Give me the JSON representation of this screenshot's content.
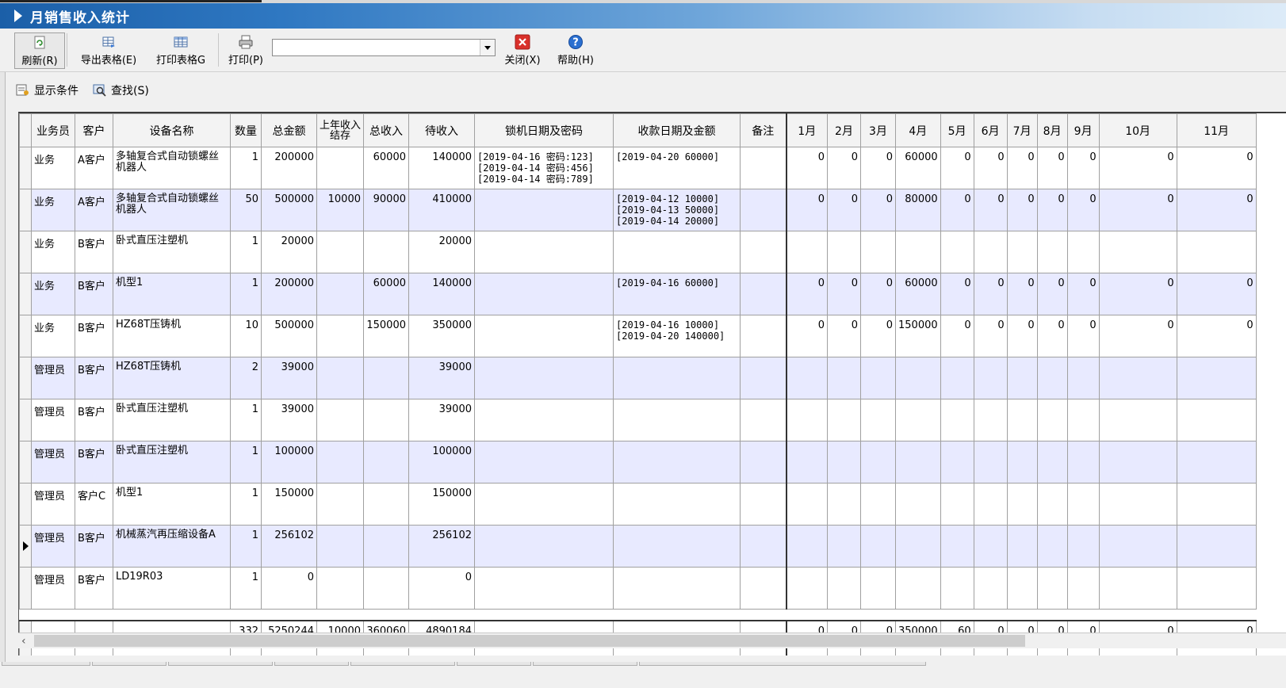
{
  "window": {
    "title": "月销售收入统计"
  },
  "toolbar": {
    "refresh": "刷新(R)",
    "export": "导出表格(E)",
    "print_table": "打印表格G",
    "print": "打印(P)",
    "print_select_value": "",
    "close": "关闭(X)",
    "help": "帮助(H)"
  },
  "subbar": {
    "show_conditions": "显示条件",
    "find": "查找(S)"
  },
  "grid": {
    "columns": [
      "业务员",
      "客户",
      "设备名称",
      "数量",
      "总金额",
      "上年收入结存",
      "总收入",
      "待收入",
      "锁机日期及密码",
      "收款日期及金额",
      "备注",
      "1月",
      "2月",
      "3月",
      "4月",
      "5月",
      "6月",
      "7月",
      "8月",
      "9月",
      "10月",
      "11月"
    ],
    "rows": [
      [
        "业务",
        "A客户",
        "多轴复合式自动锁螺丝机器人",
        "1",
        "200000",
        "",
        "60000",
        "140000",
        "[2019-04-16 密码:123]\n[2019-04-14 密码:456]\n[2019-04-14 密码:789]",
        "[2019-04-20 60000]",
        "",
        "0",
        "0",
        "0",
        "60000",
        "0",
        "0",
        "0",
        "0",
        "0",
        "0",
        "0"
      ],
      [
        "业务",
        "A客户",
        "多轴复合式自动锁螺丝机器人",
        "50",
        "500000",
        "10000",
        "90000",
        "410000",
        "",
        "[2019-04-12 10000]\n[2019-04-13 50000]\n[2019-04-14 20000]",
        "",
        "0",
        "0",
        "0",
        "80000",
        "0",
        "0",
        "0",
        "0",
        "0",
        "0",
        "0"
      ],
      [
        "业务",
        "B客户",
        "卧式直压注塑机",
        "1",
        "20000",
        "",
        "",
        "20000",
        "",
        "",
        "",
        "",
        "",
        "",
        "",
        "",
        "",
        "",
        "",
        "",
        "",
        ""
      ],
      [
        "业务",
        "B客户",
        "机型1",
        "1",
        "200000",
        "",
        "60000",
        "140000",
        "",
        "[2019-04-16 60000]",
        "",
        "0",
        "0",
        "0",
        "60000",
        "0",
        "0",
        "0",
        "0",
        "0",
        "0",
        "0"
      ],
      [
        "业务",
        "B客户",
        "HZ68T压铸机",
        "10",
        "500000",
        "",
        "150000",
        "350000",
        "",
        "[2019-04-16 10000]\n[2019-04-20 140000]",
        "",
        "0",
        "0",
        "0",
        "150000",
        "0",
        "0",
        "0",
        "0",
        "0",
        "0",
        "0"
      ],
      [
        "管理员",
        "B客户",
        "HZ68T压铸机",
        "2",
        "39000",
        "",
        "",
        "39000",
        "",
        "",
        "",
        "",
        "",
        "",
        "",
        "",
        "",
        "",
        "",
        "",
        "",
        ""
      ],
      [
        "管理员",
        "B客户",
        "卧式直压注塑机",
        "1",
        "39000",
        "",
        "",
        "39000",
        "",
        "",
        "",
        "",
        "",
        "",
        "",
        "",
        "",
        "",
        "",
        "",
        "",
        ""
      ],
      [
        "管理员",
        "B客户",
        "卧式直压注塑机",
        "1",
        "100000",
        "",
        "",
        "100000",
        "",
        "",
        "",
        "",
        "",
        "",
        "",
        "",
        "",
        "",
        "",
        "",
        "",
        ""
      ],
      [
        "管理员",
        "客户C",
        "机型1",
        "1",
        "150000",
        "",
        "",
        "150000",
        "",
        "",
        "",
        "",
        "",
        "",
        "",
        "",
        "",
        "",
        "",
        "",
        "",
        ""
      ],
      [
        "管理员",
        "B客户",
        "机械蒸汽再压缩设备A",
        "1",
        "256102",
        "",
        "",
        "256102",
        "",
        "",
        "",
        "",
        "",
        "",
        "",
        "",
        "",
        "",
        "",
        "",
        "",
        ""
      ],
      [
        "管理员",
        "B客户",
        "LD19R03",
        "1",
        "0",
        "",
        "",
        "0",
        "",
        "",
        "",
        "",
        "",
        "",
        "",
        "",
        "",
        "",
        "",
        "",
        "",
        ""
      ]
    ],
    "current_row": 9,
    "totals": [
      "",
      "",
      "",
      "332",
      "5250244",
      "10000",
      "360060",
      "4890184",
      "",
      "",
      "",
      "0",
      "0",
      "0",
      "350000",
      "60",
      "0",
      "0",
      "0",
      "0",
      "0",
      "0"
    ]
  },
  "icons": {
    "refresh": "refresh-icon",
    "export": "export-table-icon",
    "print_table": "table-icon",
    "print": "printer-icon",
    "close": "close-icon",
    "help": "help-icon",
    "show_conditions": "filter-icon",
    "find": "find-icon"
  },
  "colors": {
    "title_bar": "#1b5fa8",
    "alt_row": "#e8eaff",
    "close_red": "#d9302a",
    "help_blue": "#2a6fd0"
  }
}
